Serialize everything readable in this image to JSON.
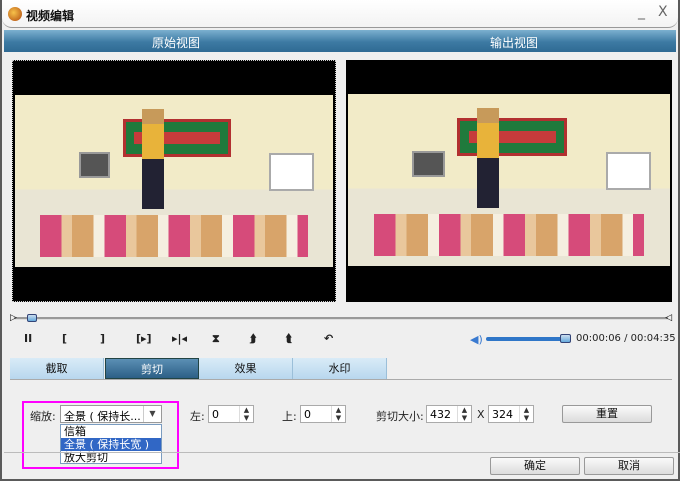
{
  "window": {
    "title": "视频编辑",
    "minimize": "_",
    "close": "X"
  },
  "views": {
    "original": "原始视图",
    "output": "输出视图"
  },
  "playback": {
    "controls": [
      {
        "name": "pause-button",
        "glyph": "II"
      },
      {
        "name": "mark-in-button",
        "glyph": "["
      },
      {
        "name": "mark-out-button",
        "glyph": "]"
      },
      {
        "name": "play-selection-button",
        "glyph": "[▸]"
      },
      {
        "name": "step-button",
        "glyph": "▸|◂"
      },
      {
        "name": "flip-vertical-button",
        "glyph": "⧗"
      },
      {
        "name": "rotate-right-button",
        "glyph": "⮭"
      },
      {
        "name": "rotate-left-button",
        "glyph": "⮬"
      },
      {
        "name": "undo-rotate-button",
        "glyph": "↶"
      }
    ],
    "current_time": "00:00:06",
    "total_time": "00:04:35",
    "time_display": "00:00:06 / 00:04:35",
    "progress_percent": 2,
    "volume_percent": 100
  },
  "tabs": [
    {
      "label": "截取"
    },
    {
      "label": "剪切",
      "active": true
    },
    {
      "label": "效果"
    },
    {
      "label": "水印"
    }
  ],
  "crop": {
    "zoom_label": "缩放:",
    "zoom_value": "全景 ( 保持长...",
    "zoom_options": [
      "信箱",
      "全景 ( 保持长宽 )",
      "放大剪切"
    ],
    "zoom_selected_index": 1,
    "left_label": "左:",
    "left_value": "0",
    "top_label": "上:",
    "top_value": "0",
    "size_label": "剪切大小:",
    "width_value": "432",
    "x_label": "X",
    "height_value": "324",
    "reset_label": "重置"
  },
  "footer": {
    "ok_label": "确定",
    "cancel_label": "取消"
  },
  "colors": {
    "highlight": "#ff00ff",
    "header": "#3d7aa3",
    "selection": "#3167c5"
  }
}
